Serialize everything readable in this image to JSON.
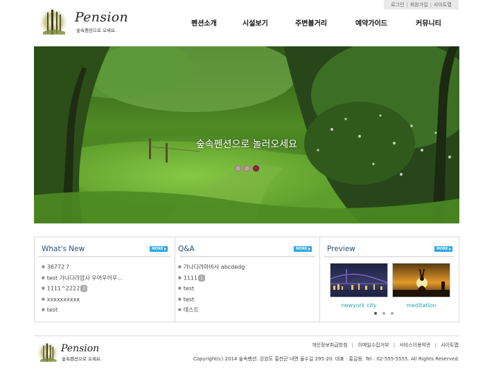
{
  "util_links": [
    "로그인",
    "회원가입",
    "사이트맵"
  ],
  "logo": {
    "title": "Pension",
    "subtitle": "숲속펜션으로 오세요."
  },
  "nav": [
    "펜션소개",
    "시설보기",
    "주변볼거리",
    "예약가이드",
    "커뮤니티"
  ],
  "hero": {
    "caption": "숲속펜션으로 놀러오세요",
    "slide_count": 3,
    "active_slide": 3
  },
  "whats_new": {
    "title": "What's New",
    "more_label": "MORE",
    "items": [
      {
        "text": "36772 ?",
        "badge": ""
      },
      {
        "text": "test 가나다라압사 우어우어우...",
        "badge": ""
      },
      {
        "text": "1111^2222",
        "badge": "3"
      },
      {
        "text": "xxxxxxxxxx",
        "badge": ""
      },
      {
        "text": "test",
        "badge": ""
      }
    ]
  },
  "qna": {
    "title": "Q&A",
    "more_label": "MORE",
    "items": [
      {
        "text": "가나다라마바사 abcdedg",
        "badge": ""
      },
      {
        "text": "1111",
        "badge": "1"
      },
      {
        "text": "test",
        "badge": ""
      },
      {
        "text": "test",
        "badge": ""
      },
      {
        "text": "테스트",
        "badge": ""
      }
    ]
  },
  "preview": {
    "title": "Preview",
    "more_label": "MORE",
    "items": [
      {
        "caption": "newyork city"
      },
      {
        "caption": "meditation"
      }
    ],
    "page_count": 3,
    "active_page": 1
  },
  "footer": {
    "logo_title": "Pension",
    "logo_subtitle": "숲속펜션으로 오세요.",
    "links": [
      "개인정보취급방침",
      "이메일수집거부",
      "서비스이용약관",
      "사이트맵"
    ],
    "copyright": "Copyright(c) 2014 숲속펜션. 강원도 홍천군 내면 율수길 295-20. 대표 : 홍길동. Tel : 02-555-5555. All Rights Reserved."
  },
  "colors": {
    "accent_blue": "#2aa7e6",
    "title_blue": "#1f4d7a",
    "caption_teal": "#26a3a8",
    "dot_active": "#9c1f4e"
  }
}
